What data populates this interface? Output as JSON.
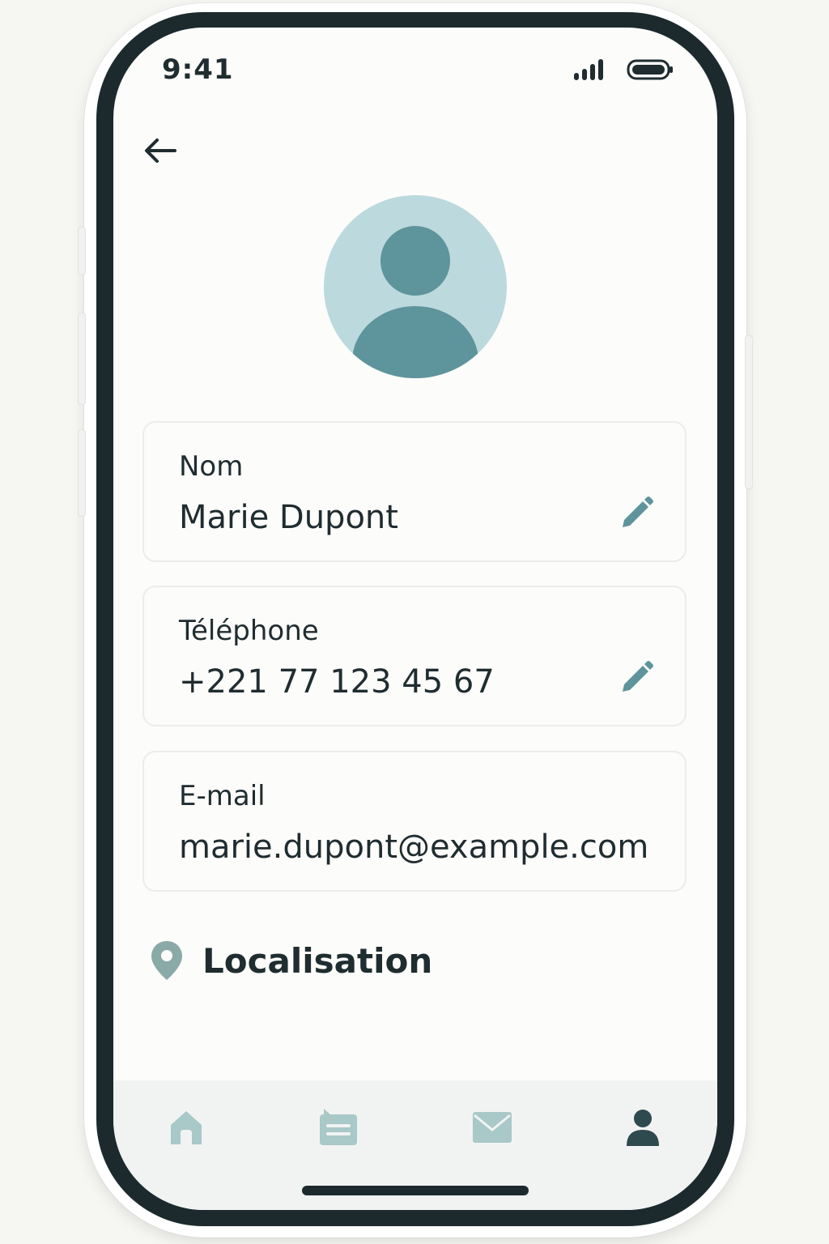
{
  "status_bar": {
    "time": "9:41"
  },
  "header": {
    "back_icon": "arrow-left-icon"
  },
  "profile": {
    "avatar_icon": "user-avatar-icon"
  },
  "fields": {
    "name": {
      "label": "Nom",
      "value": "Marie Dupont",
      "editable": true
    },
    "phone": {
      "label": "Téléphone",
      "value": "+221 77 123 45 67",
      "editable": true
    },
    "email": {
      "label": "E-mail",
      "value": "marie.dupont@example.com",
      "editable": false
    }
  },
  "location": {
    "label": "Localisation",
    "icon": "map-pin-icon"
  },
  "bottom_nav": {
    "items": [
      {
        "icon": "home-icon",
        "active": false
      },
      {
        "icon": "messages-icon",
        "active": false
      },
      {
        "icon": "mail-icon",
        "active": false
      },
      {
        "icon": "profile-icon",
        "active": true
      }
    ]
  },
  "colors": {
    "accent": "#5e949b",
    "accent_light": "#bcd9dd",
    "inactive_icon": "#a9c8c8",
    "text": "#1f2c30",
    "bezel": "#1c2a2e"
  }
}
